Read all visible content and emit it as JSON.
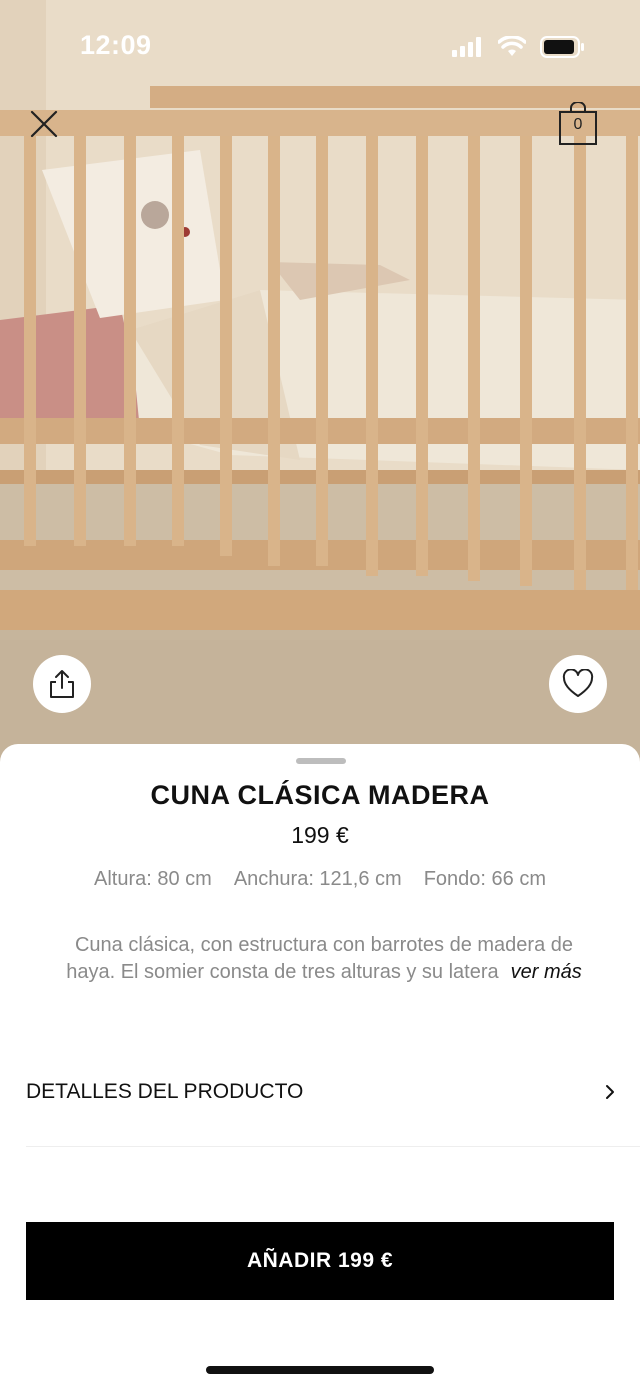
{
  "status_bar": {
    "time": "12:09"
  },
  "product": {
    "title": "CUNA CLÁSICA MADERA",
    "price": "199 €",
    "dimensions": [
      "Altura: 80 cm",
      "Anchura: 121,6 cm",
      "Fondo: 66 cm"
    ],
    "description_line1": "Cuna clásica, con estructura con barrotes de madera de",
    "description_line2": "haya. El somier consta de tres alturas y su latera",
    "see_more": "ver más"
  },
  "cart": {
    "count": "0"
  },
  "sections": {
    "details_label": "DETALLES DEL PRODUCTO"
  },
  "actions": {
    "add_label": "AÑADIR 199 €"
  }
}
